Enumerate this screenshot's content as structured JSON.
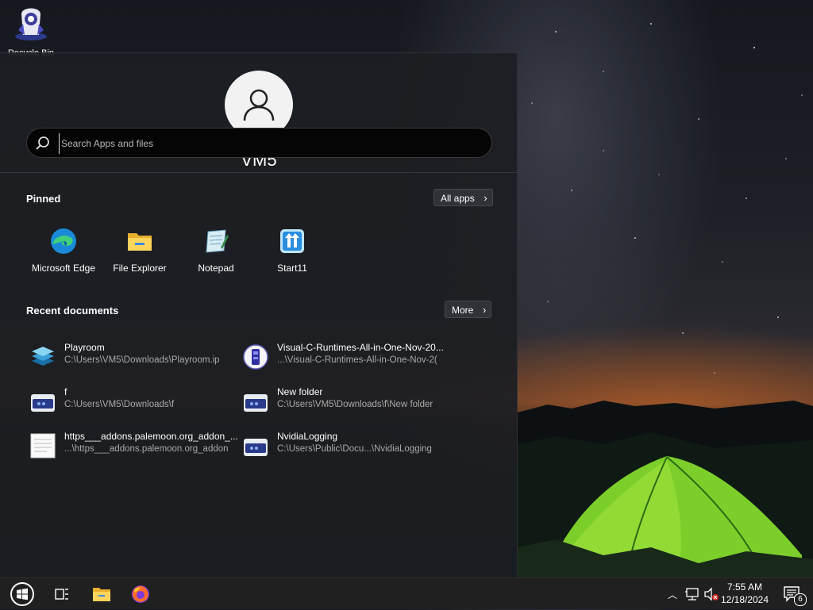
{
  "desktop": {
    "recycle_bin_label": "Recycle Bin"
  },
  "start_menu": {
    "user_name": "VM5",
    "search_placeholder": "Search Apps and files",
    "pinned_title": "Pinned",
    "all_apps_label": "All apps",
    "pinned_apps": [
      {
        "label": "Microsoft Edge",
        "icon": "edge-icon"
      },
      {
        "label": "File Explorer",
        "icon": "folder-icon"
      },
      {
        "label": "Notepad",
        "icon": "notepad-icon"
      },
      {
        "label": "Start11",
        "icon": "start11-icon"
      }
    ],
    "recent_title": "Recent documents",
    "more_label": "More",
    "recent_docs": [
      {
        "name": "Playroom",
        "path": "C:\\Users\\VM5\\Downloads\\Playroom.ip",
        "icon": "stack-icon"
      },
      {
        "name": "Visual-C-Runtimes-All-in-One-Nov-20...",
        "path": "...\\Visual-C-Runtimes-All-in-One-Nov-2(",
        "icon": "installer-icon"
      },
      {
        "name": "f",
        "path": "C:\\Users\\VM5\\Downloads\\f",
        "icon": "drive-folder-icon"
      },
      {
        "name": "New folder",
        "path": "C:\\Users\\VM5\\Downloads\\f\\New folder",
        "icon": "drive-folder-icon"
      },
      {
        "name": "https___addons.palemoon.org_addon_...",
        "path": "...\\https___addons.palemoon.org_addon",
        "icon": "document-icon"
      },
      {
        "name": "NvidiaLogging",
        "path": "C:\\Users\\Public\\Docu...\\NvidiaLogging",
        "icon": "drive-folder-icon"
      }
    ]
  },
  "taskbar": {
    "time": "7:55 AM",
    "date": "12/18/2024",
    "notification_count": "6"
  },
  "colors": {
    "menu_bg": "#1c1e22",
    "taskbar_bg": "#202020",
    "accent_orange": "#f07020"
  }
}
